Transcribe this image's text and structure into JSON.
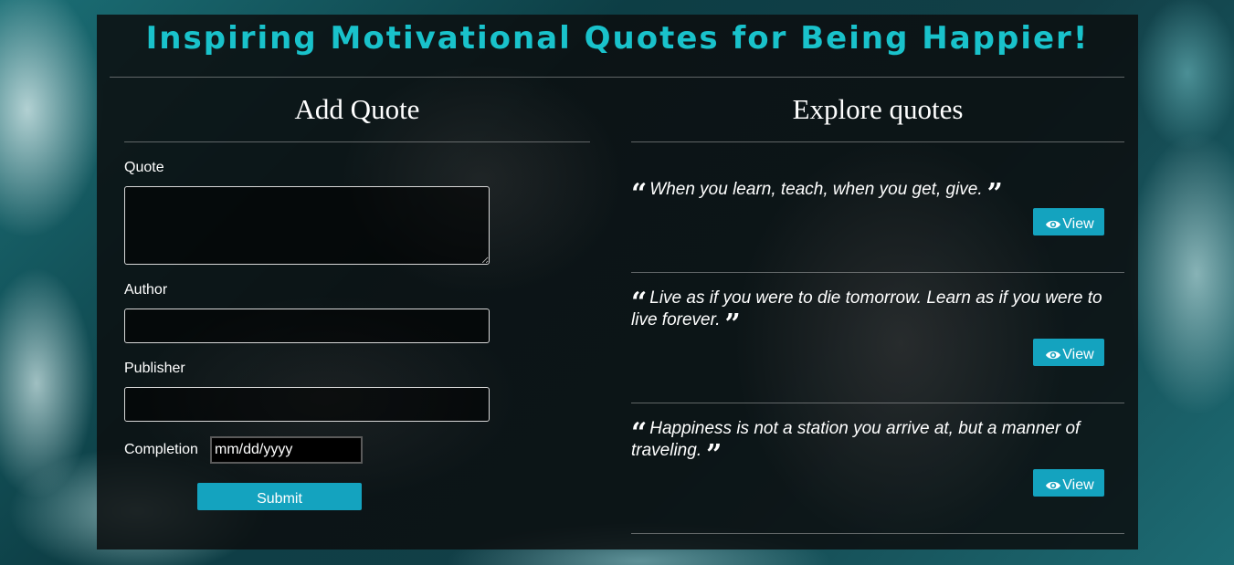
{
  "page": {
    "title": "Inspiring Motivational Quotes for Being Happier!"
  },
  "add_form": {
    "heading": "Add Quote",
    "quote_label": "Quote",
    "quote_value": "",
    "author_label": "Author",
    "author_value": "",
    "publisher_label": "Publisher",
    "publisher_value": "",
    "completion_label": "Completion",
    "completion_placeholder": "mm/dd/yyyy",
    "submit_label": "Submit"
  },
  "explore": {
    "heading": "Explore quotes",
    "view_label": "View",
    "quotes": [
      {
        "text": "When you learn, teach, when you get, give."
      },
      {
        "text": "Live as if you were to die tomorrow. Learn as if you were to live forever."
      },
      {
        "text": "Happiness is not a station you arrive at, but a manner of traveling."
      }
    ]
  },
  "icons": {
    "open_quote": "quote-left-icon",
    "close_quote": "quote-right-icon",
    "view": "eye-icon"
  },
  "colors": {
    "title": "#19c2cb",
    "button": "#14a3bf",
    "panel": "#0c0e0f"
  }
}
